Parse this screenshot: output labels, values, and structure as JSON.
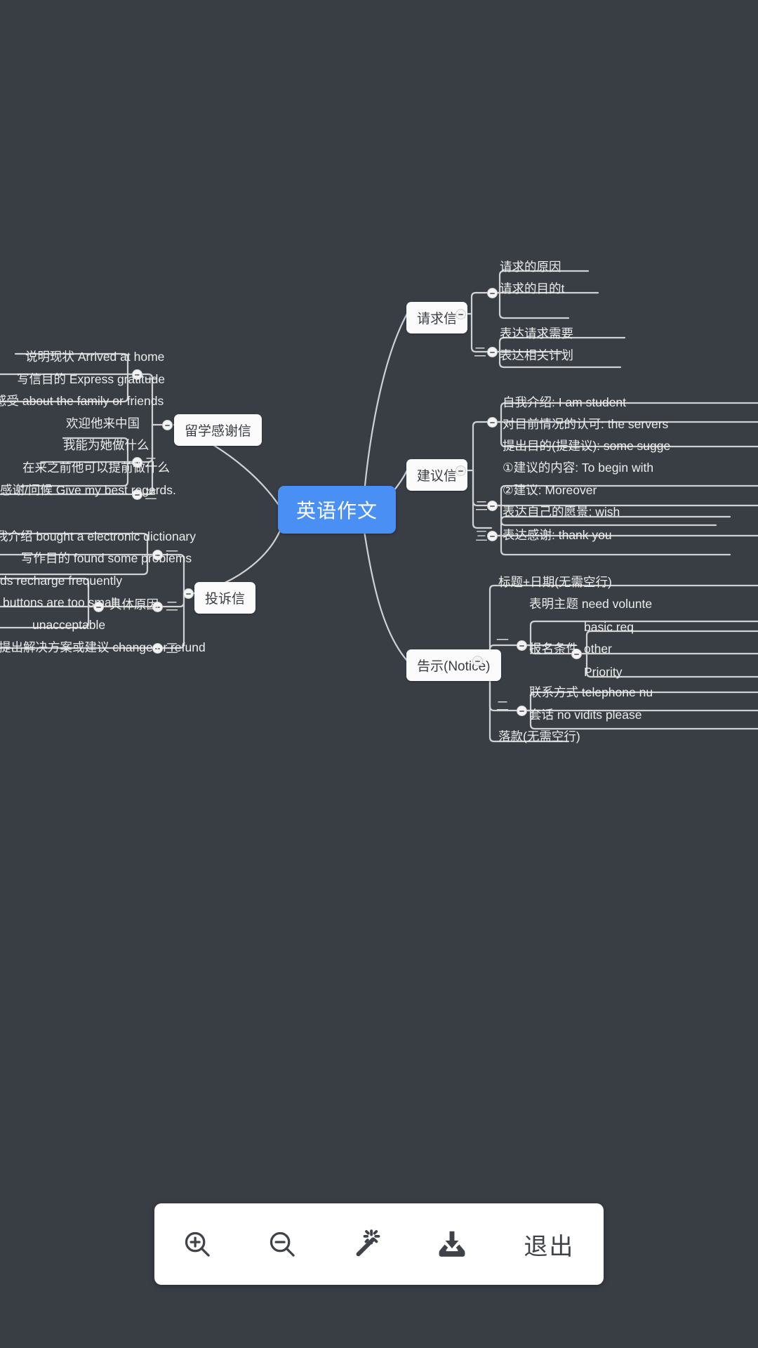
{
  "app": {
    "background_color": "#393d44",
    "root_color": "#4a90f4"
  },
  "mindmap": {
    "root": {
      "label": "英语作文"
    },
    "branches": [
      {
        "id": "request-letter",
        "label": "请求信",
        "side": "right",
        "groups": [
          {
            "marker": "一",
            "items": [
              "请求的原因",
              "请求的目的t",
              ""
            ]
          },
          {
            "marker": "二",
            "items": [
              "表达请求需要",
              "表达相关计划"
            ]
          }
        ]
      },
      {
        "id": "suggestion-letter",
        "label": "建议信",
        "side": "right",
        "groups": [
          {
            "marker": "一",
            "items": [
              "自我介绍: I am student",
              "对目前情况的认可: the servers",
              "提出目的(提建议): some sugge"
            ]
          },
          {
            "marker": "二",
            "items": [
              "①建议的内容: To begin with",
              "②建议: Moreover"
            ]
          },
          {
            "marker": "三",
            "items": [
              "表达自己的愿景: wish",
              "表达感谢: thank you"
            ]
          }
        ]
      },
      {
        "id": "notice",
        "label": "告示(Notice)",
        "side": "right",
        "groups": [
          {
            "marker": "一",
            "items": [
              "标题+日期(无需空行)",
              "表明主题 need volunte",
              "报名条件"
            ],
            "sub": [
              "basic req",
              "other",
              "Priority"
            ]
          },
          {
            "marker": "二",
            "items": [
              "联系方式 telephone nu",
              "套话 no vidits please"
            ]
          },
          {
            "marker": "",
            "items": [
              "落款(无需空行)"
            ]
          }
        ]
      },
      {
        "id": "thanks-letter",
        "label": "留学感谢信",
        "side": "left",
        "groups": [
          {
            "marker": "一",
            "items": [
              "说明现状 Arrived at home",
              "写信目的 Express gratitude",
              "感受 about the family or friends"
            ]
          },
          {
            "marker": "二",
            "items": [
              "欢迎他来中国",
              "我能为她做什么",
              "在来之前他可以提前做什么"
            ]
          },
          {
            "marker": "三",
            "items": [
              "感谢/问候 Give my best regards."
            ]
          }
        ]
      },
      {
        "id": "complaint-letter",
        "label": "投诉信",
        "side": "left",
        "groups": [
          {
            "marker": "一",
            "items": [
              "我介绍 bought a electronic dictionary",
              "写作目的 found some problems"
            ]
          },
          {
            "marker": "二",
            "label": "具体原因",
            "items": [
              "ds recharge frequently",
              "buttons are too small",
              "unacceptable"
            ]
          },
          {
            "marker": "三",
            "items": [
              "提出解决方案或建议 change or refund"
            ]
          }
        ]
      }
    ]
  },
  "toolbar": {
    "buttons": [
      {
        "id": "zoom-in",
        "icon": "zoom-in-icon",
        "label": ""
      },
      {
        "id": "zoom-out",
        "icon": "zoom-out-icon",
        "label": ""
      },
      {
        "id": "beautify",
        "icon": "magic-wand-icon",
        "label": ""
      },
      {
        "id": "download",
        "icon": "download-icon",
        "label": ""
      },
      {
        "id": "exit",
        "icon": "",
        "label": "退出"
      }
    ]
  }
}
